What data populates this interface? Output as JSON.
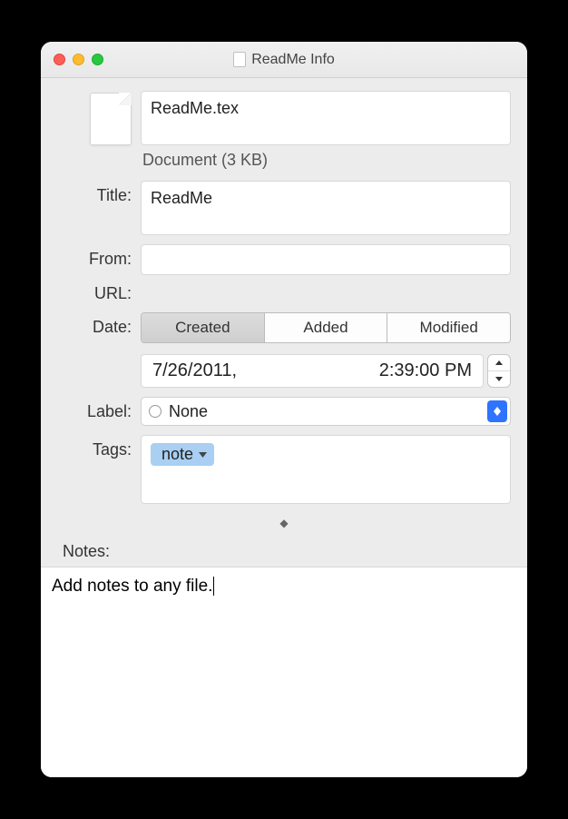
{
  "window": {
    "title": "ReadMe Info"
  },
  "file": {
    "name": "ReadMe.tex",
    "kind_size": "Document (3 KB)"
  },
  "labels": {
    "title": "Title:",
    "from": "From:",
    "url": "URL:",
    "date": "Date:",
    "label": "Label:",
    "tags": "Tags:",
    "notes": "Notes:"
  },
  "field_title": {
    "value": "ReadMe"
  },
  "field_from": {
    "value": ""
  },
  "date": {
    "segments": {
      "created": "Created",
      "added": "Added",
      "modified": "Modified"
    },
    "value_date": "7/26/2011,",
    "value_time": "2:39:00 PM"
  },
  "label_select": {
    "value": "None"
  },
  "tags": {
    "chip": "note"
  },
  "notes": {
    "text": "Add notes to any file."
  }
}
